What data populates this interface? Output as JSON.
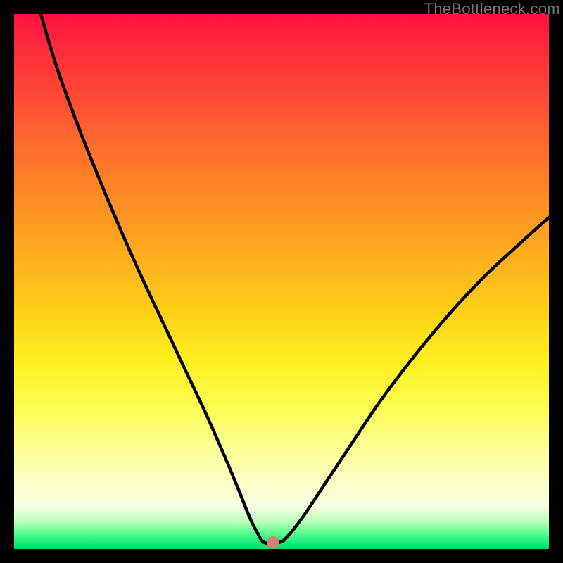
{
  "watermark": "TheBottleneck.com",
  "colors": {
    "curve_stroke": "#000000",
    "dot_fill": "#d58074",
    "frame": "#000000"
  },
  "chart_data": {
    "type": "line",
    "title": "",
    "xlabel": "",
    "ylabel": "",
    "xlim": [
      0,
      100
    ],
    "ylim": [
      0,
      100
    ],
    "grid": false,
    "legend": false,
    "comment": "V-shaped bottleneck curve on rainbow gradient; axes unlabeled. Values are normalised 0-100 on both axes, read approximately from pixel positions.",
    "series": [
      {
        "name": "bottleneck-curve",
        "x": [
          5,
          8,
          12,
          16,
          20,
          24,
          28,
          32,
          36,
          39.5,
          42,
          44,
          45.5,
          46.8,
          49.5,
          51,
          54,
          58,
          63,
          68,
          74,
          81,
          88,
          95,
          100
        ],
        "y": [
          100,
          90,
          79,
          69,
          59.5,
          50.5,
          42,
          33.5,
          25,
          17,
          11,
          6,
          3,
          1.2,
          1.2,
          2.2,
          6,
          12,
          19.5,
          27,
          35,
          43.5,
          51,
          57.5,
          62
        ]
      }
    ],
    "marker": {
      "x": 48.4,
      "y": 1.2
    }
  }
}
